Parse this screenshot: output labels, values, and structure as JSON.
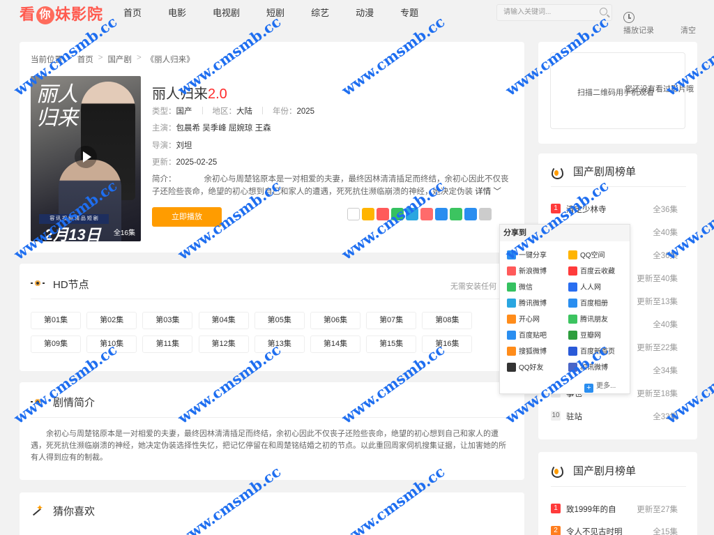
{
  "header": {
    "logo": "看你妹影院",
    "nav": [
      "首页",
      "电影",
      "电视剧",
      "短剧",
      "综艺",
      "动漫",
      "专题"
    ],
    "search_placeholder": "请输入关键词...",
    "history_label": "播放记录",
    "clear_label": "清空"
  },
  "breadcrumb": [
    "当前位置",
    "首页",
    "国产剧",
    "《丽人归来》"
  ],
  "detail": {
    "title": "丽人归来",
    "score": "2.0",
    "type_label": "类型：",
    "type": "国产",
    "area_label": "地区：",
    "area": "大陆",
    "year_label": "年份：",
    "year": "2025",
    "actors_label": "主演：",
    "actors": [
      "包晨希",
      "吴季峰",
      "屈婉琼",
      "王森"
    ],
    "director_label": "导演：",
    "director": "刘坦",
    "update_label": "更新：",
    "update": "2025-02-25",
    "intro_label": "简介：",
    "intro": "余初心与周楚铭原本是一对相爱的夫妻，最终因林清清插足而终结，余初心因此不仅丧子还险些丧命，绝望的初心想到自己和家人的遭遇，死死抗住濒临崩溃的神经，她决定伪装",
    "more": "详情",
    "play_button": "立即播放",
    "poster": {
      "title": "丽人归来",
      "date": "2月13日",
      "band": "容 讯 视 频 精 品 短 剧",
      "episodes": "全16集"
    }
  },
  "hd": {
    "title": "HD节点",
    "note": "无需安装任何",
    "episodes": [
      "第01集",
      "第02集",
      "第03集",
      "第04集",
      "第05集",
      "第06集",
      "第07集",
      "第08集",
      "第09集",
      "第10集",
      "第11集",
      "第12集",
      "第13集",
      "第14集",
      "第15集",
      "第16集"
    ]
  },
  "plot": {
    "title": "剧情简介",
    "text": "余初心与周楚铭原本是一对相爱的夫妻，最终因林清清插足而终结，余初心因此不仅丧子还险些丧命，绝望的初心想到自己和家人的遭遇，死死抗住濒临崩溃的神经，她决定伪装选择性失忆，把记忆停留在和周楚铭结婚之初的节点。以此重回周家伺机搜集证据，让加害她的所有人得到应有的制裁。"
  },
  "guess": {
    "title": "猜你喜欢"
  },
  "qr": {
    "text1": "扫描二维码用手机观看",
    "text2": "您还没有看过影片哦"
  },
  "weekly": {
    "title": "国产剧周榜单",
    "items": [
      {
        "n": "1",
        "name": "清定少林寺",
        "eps": "全36集"
      },
      {
        "n": "2",
        "name": "",
        "eps": "全40集"
      },
      {
        "n": "3",
        "name": "",
        "eps": "全36集"
      },
      {
        "n": "4",
        "name": "",
        "eps": "更新至40集"
      },
      {
        "n": "5",
        "name": "",
        "eps": "更新至13集"
      },
      {
        "n": "6",
        "name": "",
        "eps": "全40集"
      },
      {
        "n": "7",
        "name": "",
        "eps": "更新至22集"
      },
      {
        "n": "8",
        "name": "",
        "eps": "全34集"
      },
      {
        "n": "9",
        "name": "事也",
        "eps": "更新至18集"
      },
      {
        "n": "10",
        "name": "驻站",
        "eps": "全33集"
      }
    ]
  },
  "monthly": {
    "title": "国产剧月榜单",
    "items": [
      {
        "n": "1",
        "name": "致1999年的自",
        "eps": "更新至27集"
      },
      {
        "n": "2",
        "name": "令人不见古时明",
        "eps": "全15集"
      }
    ]
  },
  "share": {
    "title": "分享到",
    "items": [
      "一键分享",
      "QQ空间",
      "新浪微博",
      "百度云收藏",
      "微信",
      "人人网",
      "腾讯微博",
      "百度相册",
      "开心网",
      "腾讯朋友",
      "百度贴吧",
      "豆瓣网",
      "搜狐微博",
      "百度新首页",
      "QQ好友",
      "和讯微博"
    ],
    "more": "更多..."
  },
  "watermark": "www.cmsmb.cc",
  "colors": {
    "accent": "#ff9c00",
    "logo": "#ff5a4f",
    "score": "#ff2b2b",
    "watermark": "#1e6ef0"
  }
}
